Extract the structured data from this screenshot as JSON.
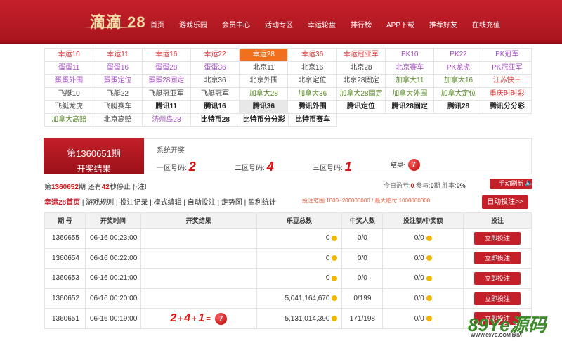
{
  "header": {
    "logo": "滴滴 28",
    "nav": [
      "首页",
      "游戏乐园",
      "会员中心",
      "活动专区",
      "幸运轮盘",
      "排行榜",
      "APP下载",
      "推荐好友",
      "在线充值"
    ]
  },
  "lottery_rows": [
    [
      {
        "t": "幸运10",
        "c": "red"
      },
      {
        "t": "幸运11",
        "c": "red"
      },
      {
        "t": "幸运16",
        "c": "red"
      },
      {
        "t": "幸运22",
        "c": "red"
      },
      {
        "t": "幸运28",
        "c": "active"
      },
      {
        "t": "幸运36",
        "c": "red"
      },
      {
        "t": "幸运冠亚军",
        "c": "red"
      },
      {
        "t": "PK10",
        "c": "purple"
      },
      {
        "t": "PK22",
        "c": "purple"
      },
      {
        "t": "PK冠军",
        "c": "purple"
      }
    ],
    [
      {
        "t": "蛋蛋11",
        "c": "purple"
      },
      {
        "t": "蛋蛋16",
        "c": "purple"
      },
      {
        "t": "蛋蛋28",
        "c": "purple"
      },
      {
        "t": "蛋蛋36",
        "c": "purple"
      },
      {
        "t": "北京11",
        "c": "dark"
      },
      {
        "t": "北京16",
        "c": "dark"
      },
      {
        "t": "北京28",
        "c": "dark"
      },
      {
        "t": "北京赛车",
        "c": "purple"
      },
      {
        "t": "PK龙虎",
        "c": "purple"
      },
      {
        "t": "PK冠亚军",
        "c": "purple"
      }
    ],
    [
      {
        "t": "蛋蛋外围",
        "c": "purple"
      },
      {
        "t": "蛋蛋定位",
        "c": "purple"
      },
      {
        "t": "蛋蛋28固定",
        "c": "purple"
      },
      {
        "t": "北京36",
        "c": "dark"
      },
      {
        "t": "北京外围",
        "c": "dark"
      },
      {
        "t": "北京定位",
        "c": "dark"
      },
      {
        "t": "北京28固定",
        "c": "dark"
      },
      {
        "t": "加拿大11",
        "c": "green"
      },
      {
        "t": "加拿大16",
        "c": "green"
      },
      {
        "t": "江苏快三",
        "c": "red"
      }
    ],
    [
      {
        "t": "飞艇10",
        "c": "dark"
      },
      {
        "t": "飞艇22",
        "c": "dark"
      },
      {
        "t": "飞艇冠亚军",
        "c": "dark"
      },
      {
        "t": "飞艇冠军",
        "c": "dark"
      },
      {
        "t": "加拿大28",
        "c": "green"
      },
      {
        "t": "加拿大36",
        "c": "green"
      },
      {
        "t": "加拿大28固定",
        "c": "green"
      },
      {
        "t": "加拿大外围",
        "c": "green"
      },
      {
        "t": "加拿大定位",
        "c": "green"
      },
      {
        "t": "重庆时时彩",
        "c": "red"
      }
    ],
    [
      {
        "t": "飞艇龙虎",
        "c": "dark"
      },
      {
        "t": "飞艇赛车",
        "c": "dark"
      },
      {
        "t": "腾讯11",
        "c": "bold"
      },
      {
        "t": "腾讯16",
        "c": "bold"
      },
      {
        "t": "腾讯36",
        "c": "gray"
      },
      {
        "t": "腾讯外围",
        "c": "bold"
      },
      {
        "t": "腾讯定位",
        "c": "bold"
      },
      {
        "t": "腾讯28固定",
        "c": "bold"
      },
      {
        "t": "腾讯28",
        "c": "bold"
      },
      {
        "t": "腾讯分分彩",
        "c": "bold"
      }
    ],
    [
      {
        "t": "加拿大高赔",
        "c": "green"
      },
      {
        "t": "北京高赔",
        "c": "dark"
      },
      {
        "t": "济州岛28",
        "c": "purple"
      },
      {
        "t": "比特币28",
        "c": "bold"
      },
      {
        "t": "比特币分分彩",
        "c": "bold"
      },
      {
        "t": "比特币赛车",
        "c": "bold"
      }
    ]
  ],
  "current": {
    "issue_label": "第1360651期",
    "issue_sub": "开奖结果",
    "system": "系统开奖",
    "zone1_label": "一区号码:",
    "zone1": "2",
    "zone2_label": "二区号码:",
    "zone2": "4",
    "zone3_label": "三区号码:",
    "zone3": "1",
    "result_label": "结果:",
    "result": "7"
  },
  "countdown": {
    "prefix": "第",
    "issue": "1360652",
    "mid": "期 还有",
    "seconds": "42",
    "suffix": "秒停止下注!"
  },
  "stats": {
    "profit_label": "今日盈亏:",
    "profit": "0",
    "join_label": "参与:",
    "join": "0",
    "join_unit": "期",
    "rate_label": "胜率:",
    "rate": "0%"
  },
  "manual_button": "手动刷新",
  "links": {
    "home": "幸运28首页",
    "rest": " | 游戏规则 | 投注记录 | 模式编辑 | 自动投注 | 走势图 | 盈利统计"
  },
  "range_text": "投注范围:1000~200000000 / 最大赔付:1000000000",
  "auto_button": "自动投注>>",
  "table": {
    "headers": [
      "期 号",
      "开奖时间",
      "开奖结果",
      "乐豆总数",
      "中奖人数",
      "投注额/中奖额",
      "投注"
    ],
    "bet_label": "立即投注",
    "rows": [
      {
        "issue": "1360655",
        "time": "06-16 00:23:00",
        "result": "",
        "total": "0",
        "winners": "0/0",
        "bet": "0/0"
      },
      {
        "issue": "1360654",
        "time": "06-16 00:22:00",
        "result": "",
        "total": "0",
        "winners": "0/0",
        "bet": "0/0"
      },
      {
        "issue": "1360653",
        "time": "06-16 00:21:00",
        "result": "",
        "total": "0",
        "winners": "0/0",
        "bet": "0/0"
      },
      {
        "issue": "1360652",
        "time": "06-16 00:20:00",
        "result": "",
        "total": "5,041,164,670",
        "winners": "0/199",
        "bet": "0/0"
      },
      {
        "issue": "1360651",
        "time": "06-16 00:19:00",
        "result": "2+4+1=7",
        "total": "5,131,014,390",
        "winners": "171/198",
        "bet": "0/0"
      }
    ],
    "last_calc": {
      "a": "2",
      "op1": "+",
      "b": "4",
      "op2": "+",
      "c": "1",
      "eq": "=",
      "res": "7"
    }
  },
  "watermark": {
    "main": "89Ye源码",
    "sub": "WWW.89YE.COM 网站"
  }
}
